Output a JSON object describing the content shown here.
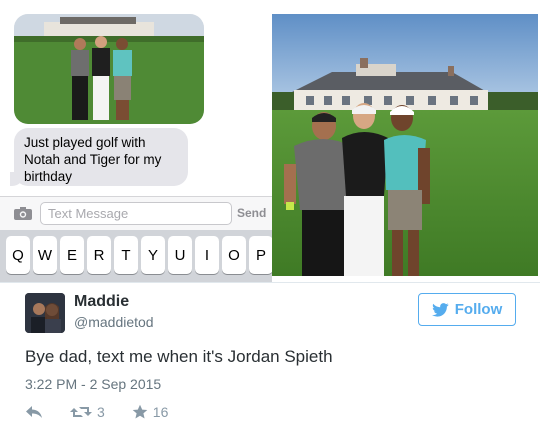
{
  "sms": {
    "message": "Just played golf with Notah and Tiger for my birthday",
    "input_placeholder": "Text Message",
    "send_label": "Send",
    "keyboard_keys": [
      "Q",
      "W",
      "E",
      "R",
      "T",
      "Y",
      "U",
      "I",
      "O",
      "P"
    ]
  },
  "tweet": {
    "name": "Maddie",
    "handle": "@maddietod",
    "follow_label": "Follow",
    "text": "Bye dad, text me when it's Jordan Spieth",
    "timestamp": "3:22 PM - 2 Sep 2015",
    "retweet_count": "3",
    "favorite_count": "16"
  },
  "colors": {
    "twitter_blue": "#55acee",
    "bubble_gray": "#e5e5ea",
    "keyboard_bg": "#d1d4d9",
    "meta_gray": "#66757f"
  },
  "icons": {
    "camera": "camera-icon",
    "bird": "twitter-bird-icon",
    "reply": "reply-icon",
    "retweet": "retweet-icon",
    "favorite": "star-icon"
  }
}
